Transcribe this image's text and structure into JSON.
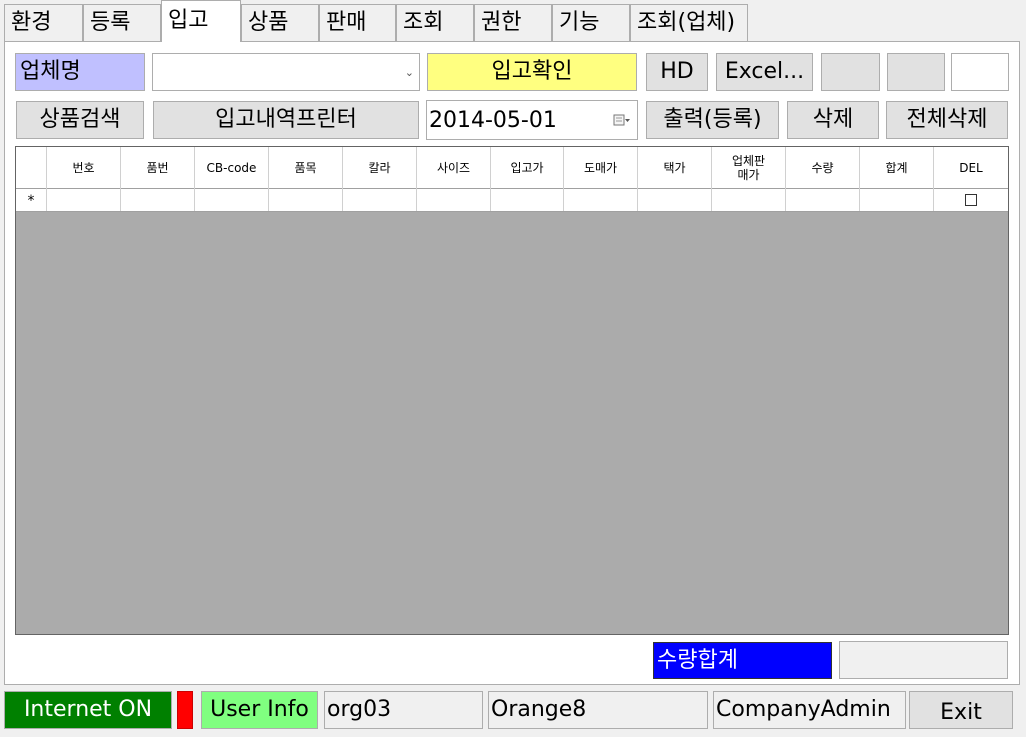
{
  "tabs": [
    "환경",
    "등록",
    "입고",
    "상품",
    "판매",
    "조회",
    "권한",
    "기능",
    "조회(업체)"
  ],
  "form": {
    "vendor_label": "업체명",
    "vendor_select_value": "",
    "confirm_label": "입고확인",
    "hd_label": "HD",
    "excel_label": "Excel...",
    "product_search_label": "상품검색",
    "print_history_label": "입고내역프린터",
    "date_value": "2014-05-01",
    "print_register_label": "출력(등록)",
    "delete_label": "삭제",
    "delete_all_label": "전체삭제"
  },
  "grid": {
    "columns": [
      "번호",
      "품번",
      "CB-code",
      "품목",
      "칼라",
      "사이즈",
      "입고가",
      "도매가",
      "택가",
      "업체판\n매가",
      "수량",
      "합계",
      "DEL"
    ],
    "new_row_marker": "*"
  },
  "summary": {
    "qty_total_label": "수량합계",
    "qty_total_value": ""
  },
  "status": {
    "internet": "Internet ON",
    "user_info": "User Info",
    "org": "org03",
    "user": "Orange8",
    "role": "CompanyAdmin",
    "exit": "Exit"
  },
  "colors": {
    "vendor_label_bg": "#c0c0ff",
    "confirm_bg": "#ffff80",
    "qty_total_bg": "#0000ff",
    "internet_bg": "#008000",
    "indicator": "#ff0000",
    "user_info_bg": "#80ff80"
  }
}
